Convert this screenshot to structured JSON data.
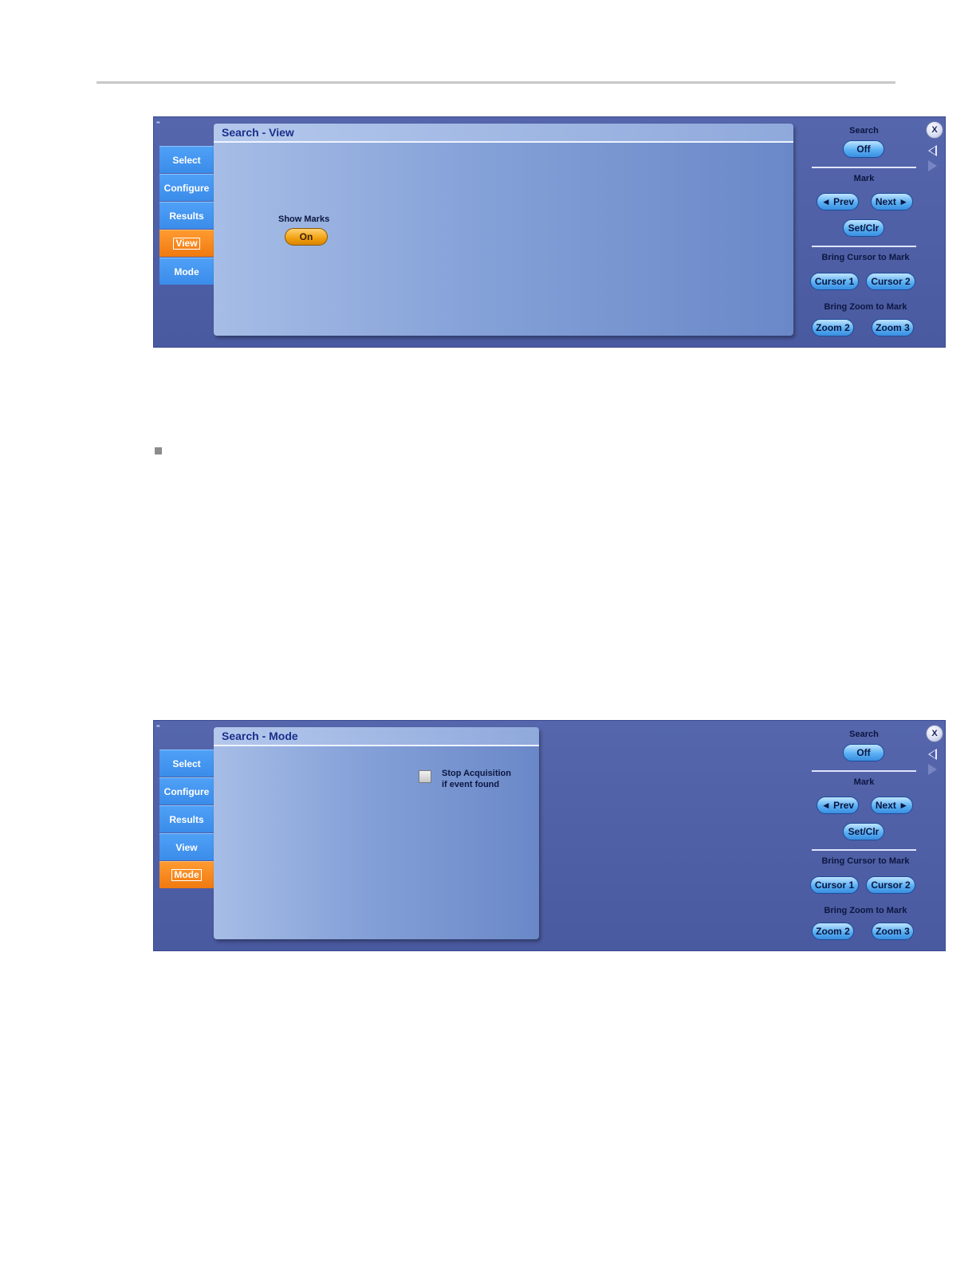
{
  "tabs": {
    "select": "Select",
    "configure": "Configure",
    "results": "Results",
    "view": "View",
    "mode": "Mode"
  },
  "view_panel": {
    "title": "Search - View",
    "show_marks_label": "Show Marks",
    "show_marks_value": "On",
    "active_tab": "View"
  },
  "mode_panel": {
    "title": "Search - Mode",
    "checkbox_label_line1": "Stop Acquisition",
    "checkbox_label_line2": "if event found",
    "checkbox_checked": false,
    "active_tab": "Mode"
  },
  "right_controls": {
    "search_label": "Search",
    "search_value": "Off",
    "mark_label": "Mark",
    "prev_label": "◄ Prev",
    "next_label": "Next ►",
    "setclr_label": "Set/Clr",
    "cursor_heading": "Bring Cursor to Mark",
    "cursor1_label": "Cursor 1",
    "cursor2_label": "Cursor 2",
    "zoom_heading": "Bring Zoom to Mark",
    "zoom2_label": "Zoom 2",
    "zoom3_label": "Zoom 3",
    "close_label": "X"
  },
  "icons": {
    "close": "close-icon",
    "back": "arrow-left-icon",
    "forward": "arrow-right-icon"
  },
  "colors": {
    "panel_bg": "#5566ac",
    "tab_blue": "#3b8cea",
    "tab_active_orange": "#f07a10",
    "title_text": "#1a2f8a"
  }
}
